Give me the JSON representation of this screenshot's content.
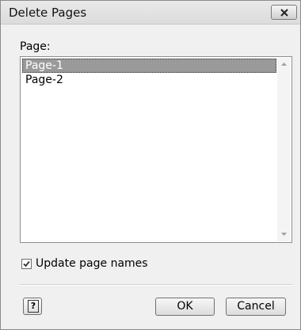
{
  "dialog": {
    "title": "Delete Pages"
  },
  "page_list": {
    "label": "Page:",
    "items": [
      "Page-1",
      "Page-2"
    ],
    "selected": "Page-1"
  },
  "options": {
    "update_page_names_label": "Update page names",
    "update_page_names_checked": true
  },
  "buttons": {
    "help_label": "?",
    "ok_label": "OK",
    "cancel_label": "Cancel"
  },
  "icons": {
    "close": "close-icon",
    "scroll_up": "scroll-up-arrow-icon",
    "scroll_down": "scroll-down-arrow-icon",
    "checkmark": "checkmark-icon",
    "help": "help-icon"
  }
}
